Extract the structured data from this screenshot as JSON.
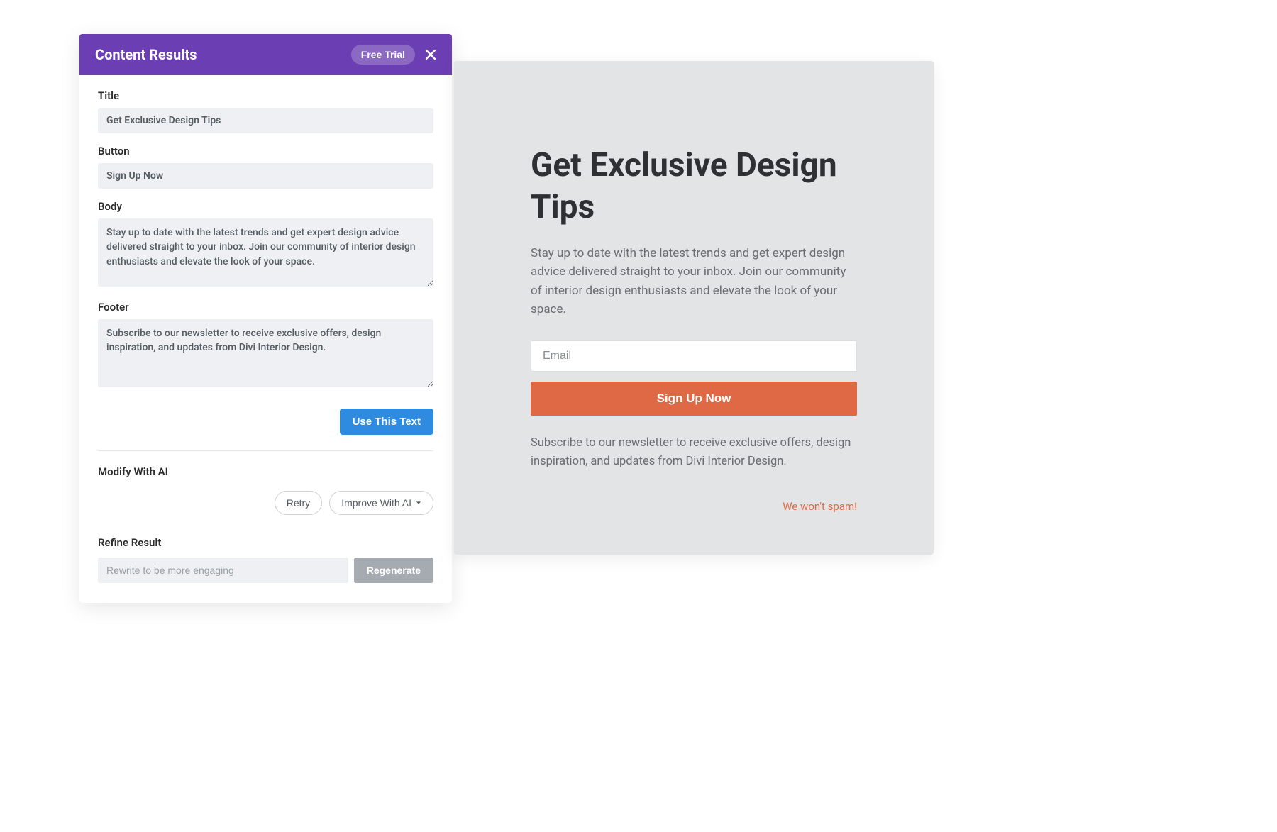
{
  "panel": {
    "header_title": "Content Results",
    "free_trial_label": "Free Trial"
  },
  "fields": {
    "title_label": "Title",
    "title_value": "Get Exclusive Design Tips",
    "button_label": "Button",
    "button_value": "Sign Up Now",
    "body_label": "Body",
    "body_value": "Stay up to date with the latest trends and get expert design advice delivered straight to your inbox. Join our community of interior design enthusiasts and elevate the look of your space.",
    "footer_label": "Footer",
    "footer_value": "Subscribe to our newsletter to receive exclusive offers, design inspiration, and updates from Divi Interior Design."
  },
  "actions": {
    "use_this_text": "Use This Text",
    "modify_label": "Modify With AI",
    "retry": "Retry",
    "improve": "Improve With AI",
    "refine_label": "Refine Result",
    "refine_placeholder": "Rewrite to be more engaging",
    "regenerate": "Regenerate"
  },
  "preview": {
    "heading": "Get Exclusive Design Tips",
    "body": "Stay up to date with the latest trends and get expert design advice delivered straight to your inbox. Join our community of interior design enthusiasts and elevate the look of your space.",
    "email_placeholder": "Email",
    "signup_label": "Sign Up Now",
    "footer": "Subscribe to our newsletter to receive exclusive offers, design inspiration, and updates from Divi Interior Design.",
    "spam_note": "We won't spam!"
  }
}
